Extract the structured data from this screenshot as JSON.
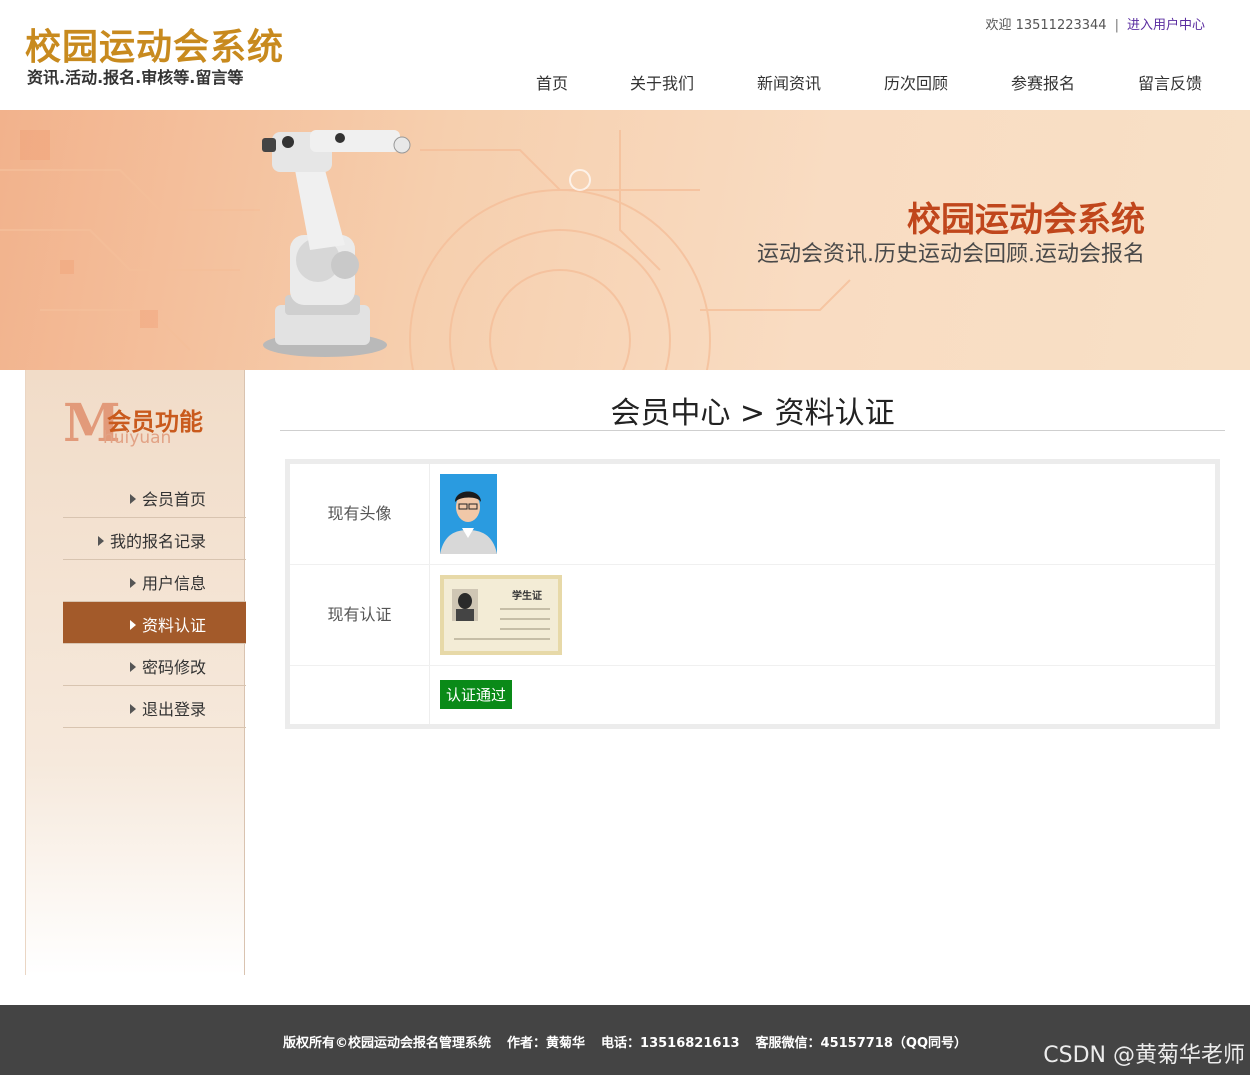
{
  "header": {
    "site_title": "校园运动会系统",
    "site_subtitle": "资讯.活动.报名.审核等.留言等",
    "welcome_text": "欢迎 13511223344",
    "separator": "|",
    "user_center_link": "进入用户中心"
  },
  "nav": {
    "items": [
      "首页",
      "关于我们",
      "新闻资讯",
      "历次回顾",
      "参赛报名",
      "留言反馈"
    ]
  },
  "banner": {
    "title": "校园运动会系统",
    "subtitle": "运动会资讯.历史运动会回顾.运动会报名"
  },
  "sidebar": {
    "logo_letter": "M",
    "title": "会员功能",
    "pinyin": "huiyuan",
    "items": [
      {
        "label": "会员首页",
        "active": false
      },
      {
        "label": "我的报名记录",
        "active": false
      },
      {
        "label": "用户信息",
        "active": false
      },
      {
        "label": "资料认证",
        "active": true
      },
      {
        "label": "密码修改",
        "active": false
      },
      {
        "label": "退出登录",
        "active": false
      }
    ]
  },
  "main": {
    "title": "会员中心 > 资料认证",
    "rows": [
      {
        "label": "现有头像"
      },
      {
        "label": "现有认证",
        "card_text": "学生证"
      },
      {
        "label": ""
      }
    ],
    "verify_button": "认证通过"
  },
  "footer": {
    "copyright": "版权所有©校园运动会报名管理系统",
    "author": "作者：黄菊华",
    "phone": "电话：13516821613",
    "wechat": "客服微信：45157718（QQ同号）"
  },
  "watermark": "CSDN @黄菊华老师",
  "colors": {
    "brand_gold": "#c88a1e",
    "banner_title": "#c0461c",
    "sidebar_active": "#a35a2a",
    "verify_green": "#0a8a18",
    "footer_bg": "#444444"
  }
}
